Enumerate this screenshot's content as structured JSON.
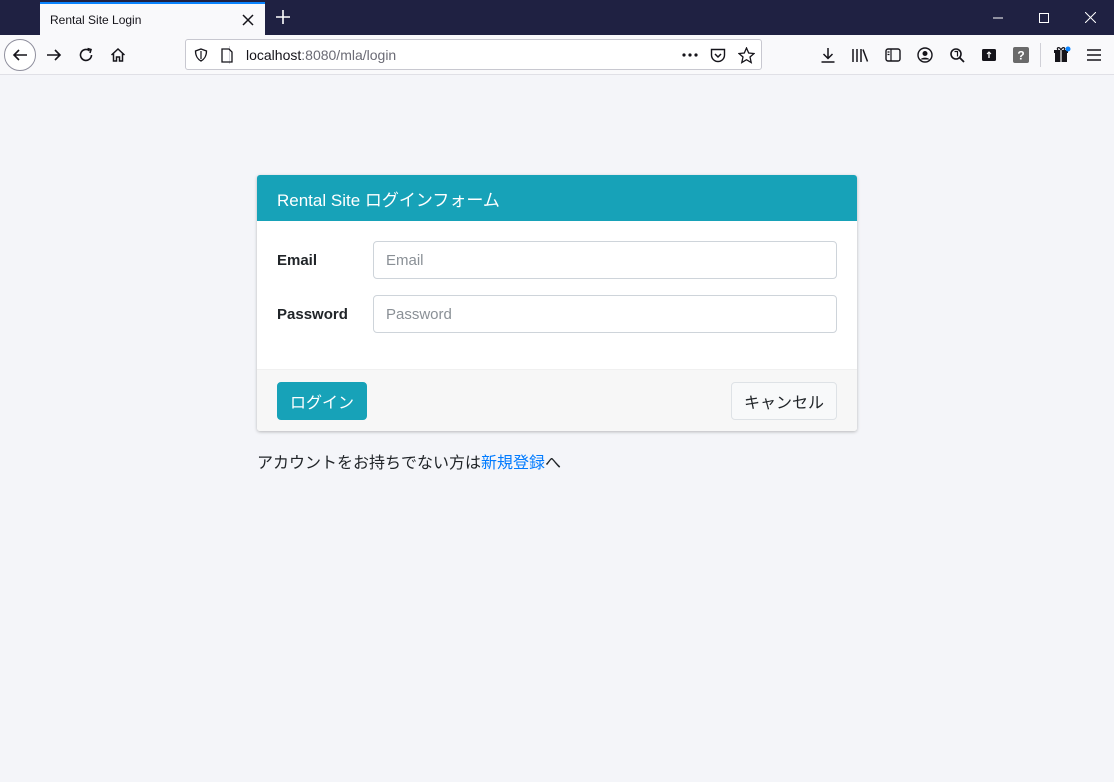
{
  "browser": {
    "tab_title": "Rental Site Login",
    "url_host": "localhost",
    "url_rest": ":8080/mla/login",
    "icons": {
      "back": "back-arrow-icon",
      "forward": "forward-arrow-icon",
      "reload": "reload-icon",
      "home": "home-icon",
      "shield": "tracking-protection-shield-icon",
      "page": "page-info-icon",
      "more": "more-actions-icon",
      "pocket": "pocket-icon",
      "bookmark": "bookmark-star-icon",
      "download": "download-icon",
      "library": "library-icon",
      "sidebar": "sidebar-icon",
      "account": "account-icon",
      "menu": "hamburger-menu-icon"
    }
  },
  "login_form": {
    "header_title": "Rental Site ログインフォーム",
    "email_label": "Email",
    "email_placeholder": "Email",
    "email_value": "",
    "password_label": "Password",
    "password_placeholder": "Password",
    "password_value": "",
    "login_button": "ログイン",
    "cancel_button": "キャンセル"
  },
  "signup": {
    "prefix": "アカウントをお持ちでない方は",
    "link": "新規登録",
    "suffix": "へ"
  },
  "colors": {
    "accent": "#17a2b8",
    "link": "#007bff",
    "titlebar": "#1f2142"
  }
}
